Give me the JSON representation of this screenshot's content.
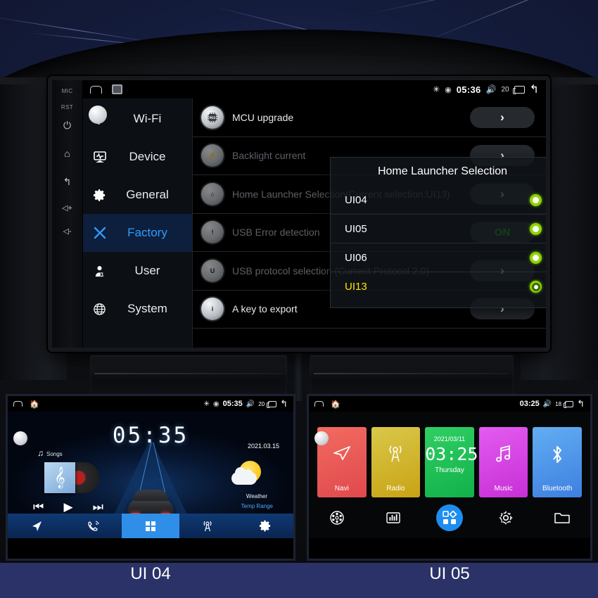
{
  "main_unit": {
    "bezel": {
      "mic": "MIC",
      "rst": "RST",
      "power_icon": "power-icon",
      "home_icon": "home-icon",
      "back_icon": "back-icon",
      "vol_up": "◁+",
      "vol_down": "◁-"
    },
    "statusbar": {
      "home_icon": "home-outline-icon",
      "photo_icon": "photo-icon",
      "bluetooth_icon": "✳",
      "wifi_icon": "◉",
      "time": "05:36",
      "volume_icon": "🔊",
      "volume": "20",
      "recents_icon": "recents-icon",
      "back_icon": "↰"
    },
    "sidebar": {
      "items": [
        {
          "label": "Wi-Fi",
          "icon": "wifi-icon",
          "active": false
        },
        {
          "label": "Device",
          "icon": "device-icon",
          "active": false
        },
        {
          "label": "General",
          "icon": "gear-icon",
          "active": false
        },
        {
          "label": "Factory",
          "icon": "tools-icon",
          "active": true
        },
        {
          "label": "User",
          "icon": "user-icon",
          "active": false
        },
        {
          "label": "System",
          "icon": "globe-icon",
          "active": false
        }
      ]
    },
    "settings_rows": [
      {
        "icon_text": "MCU",
        "label": "MCU upgrade",
        "button": "›",
        "button_type": "chevron",
        "dimmed": false
      },
      {
        "icon_text": "⚡",
        "label": "Backlight current",
        "button": "›",
        "button_type": "chevron",
        "dimmed": true
      },
      {
        "icon_text": "⌂",
        "label": "Home Launcher Selection(Current selection:UI13)",
        "button": "›",
        "button_type": "chevron",
        "dimmed": true
      },
      {
        "icon_text": "!",
        "label": "USB Error detection",
        "button": "ON",
        "button_type": "on",
        "dimmed": true
      },
      {
        "icon_text": "U",
        "label": "USB protocol selection (Current Protocol 2.0)",
        "button": "›",
        "button_type": "chevron",
        "dimmed": true
      },
      {
        "icon_text": "i",
        "label": "A key to export",
        "button": "›",
        "button_type": "chevron",
        "dimmed": false
      }
    ],
    "dialog": {
      "title": "Home Launcher Selection",
      "options": [
        {
          "label": "UI04",
          "selected": false
        },
        {
          "label": "UI05",
          "selected": false
        },
        {
          "label": "UI06",
          "selected": false
        },
        {
          "label": "UI13",
          "selected": true
        }
      ]
    }
  },
  "ui04": {
    "caption": "UI 04",
    "statusbar": {
      "time": "05:35",
      "volume": "20",
      "bluetooth_icon": "✳",
      "wifi_icon": "◉"
    },
    "clock": "05:35",
    "music_label": "Songs",
    "date": "2021.03.15",
    "weather_label": "Weather",
    "temp_label": "Temp Range",
    "controls": {
      "prev": "⏮",
      "play": "▶",
      "next": "⏭"
    },
    "dock": [
      {
        "name": "navigation",
        "icon": "➤",
        "selected": false
      },
      {
        "name": "phone",
        "icon": "📞",
        "selected": false
      },
      {
        "name": "apps",
        "icon": "grid",
        "selected": true
      },
      {
        "name": "radio",
        "icon": "📡",
        "selected": false
      },
      {
        "name": "settings",
        "icon": "⚙",
        "selected": false
      }
    ]
  },
  "ui05": {
    "caption": "UI 05",
    "statusbar": {
      "time": "03:25",
      "volume": "18"
    },
    "tiles": [
      {
        "label": "Navi",
        "icon": "navigation-icon",
        "class": "t-navi"
      },
      {
        "label": "Radio",
        "icon": "radio-tower-icon",
        "class": "t-radio"
      },
      {
        "label": "",
        "icon": "clock-tile",
        "class": "t-clock",
        "date": "2021/03/11",
        "time": "03:25",
        "day": "Thursday"
      },
      {
        "label": "Music",
        "icon": "music-note-icon",
        "class": "t-music"
      },
      {
        "label": "Bluetooth",
        "icon": "bluetooth-icon",
        "class": "t-bt"
      }
    ],
    "dock": [
      {
        "name": "video",
        "icon": "🎞",
        "selected": false
      },
      {
        "name": "equalizer",
        "icon": "📊",
        "selected": false
      },
      {
        "name": "apps",
        "icon": "grid",
        "selected": true
      },
      {
        "name": "settings",
        "icon": "⚙",
        "selected": false
      },
      {
        "name": "files",
        "icon": "🗀",
        "selected": false
      }
    ]
  }
}
